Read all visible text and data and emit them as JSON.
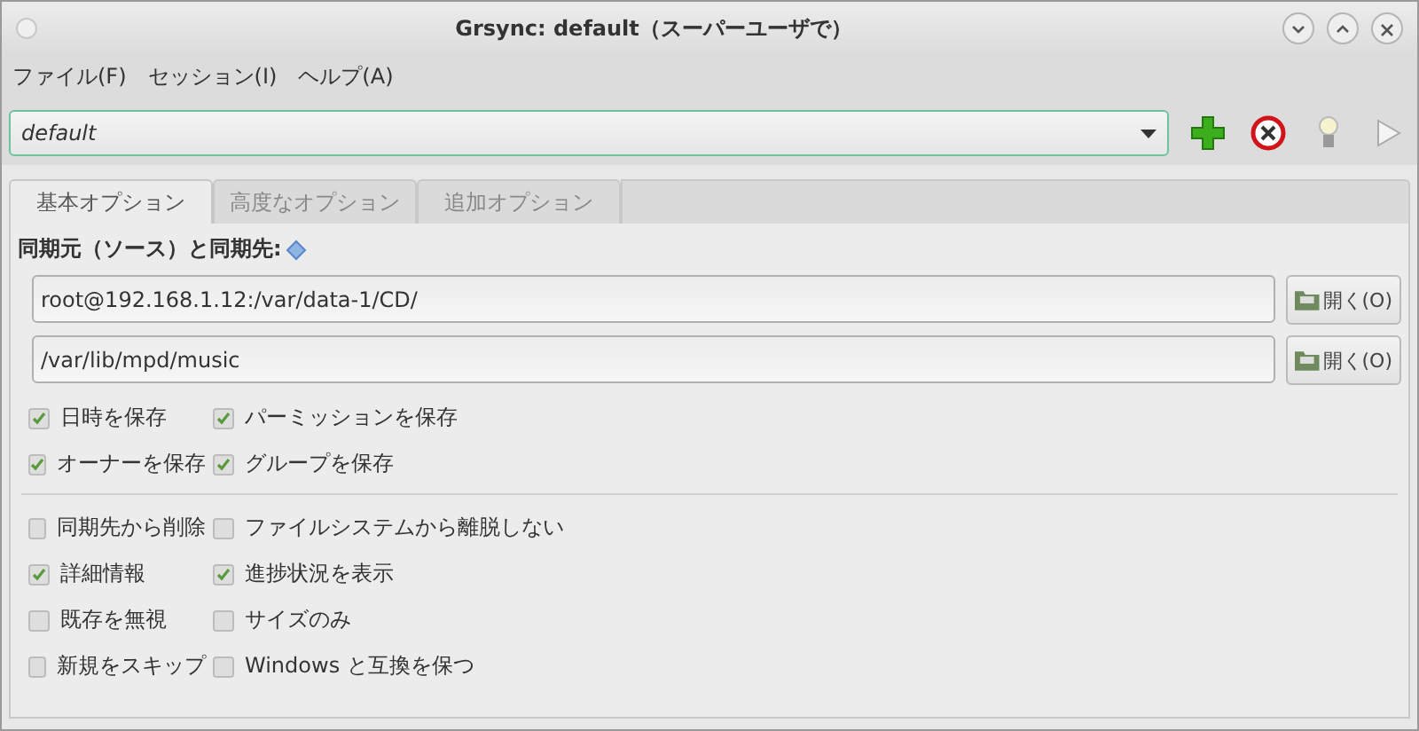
{
  "window": {
    "title": "Grsync: default（スーパーユーザで）"
  },
  "menu": [
    "ファイル(F)",
    "セッション(I)",
    "ヘルプ(A)"
  ],
  "session": {
    "value": "default"
  },
  "tabs": [
    {
      "label": "基本オプション",
      "selected": true
    },
    {
      "label": "高度なオプション",
      "selected": false
    },
    {
      "label": "追加オプション",
      "selected": false
    }
  ],
  "paths_label": "同期元（ソース）と同期先:",
  "paths": [
    {
      "value": "root@192.168.1.12:/var/data-1/CD/",
      "button": "開く(O)"
    },
    {
      "value": "/var/lib/mpd/music",
      "button": "開く(O)"
    }
  ],
  "option_groups": [
    [
      {
        "label": "日時を保存",
        "checked": true
      },
      {
        "label": "パーミッションを保存",
        "checked": true
      },
      {
        "label": "オーナーを保存",
        "checked": true
      },
      {
        "label": "グループを保存",
        "checked": true
      }
    ],
    [
      {
        "label": "同期先から削除",
        "checked": false
      },
      {
        "label": "ファイルシステムから離脱しない",
        "checked": false
      },
      {
        "label": "詳細情報",
        "checked": true
      },
      {
        "label": "進捗状況を表示",
        "checked": true
      },
      {
        "label": "既存を無視",
        "checked": false
      },
      {
        "label": "サイズのみ",
        "checked": false
      },
      {
        "label": "新規をスキップ",
        "checked": false
      },
      {
        "label": "Windows と互換を保つ",
        "checked": false
      }
    ]
  ]
}
